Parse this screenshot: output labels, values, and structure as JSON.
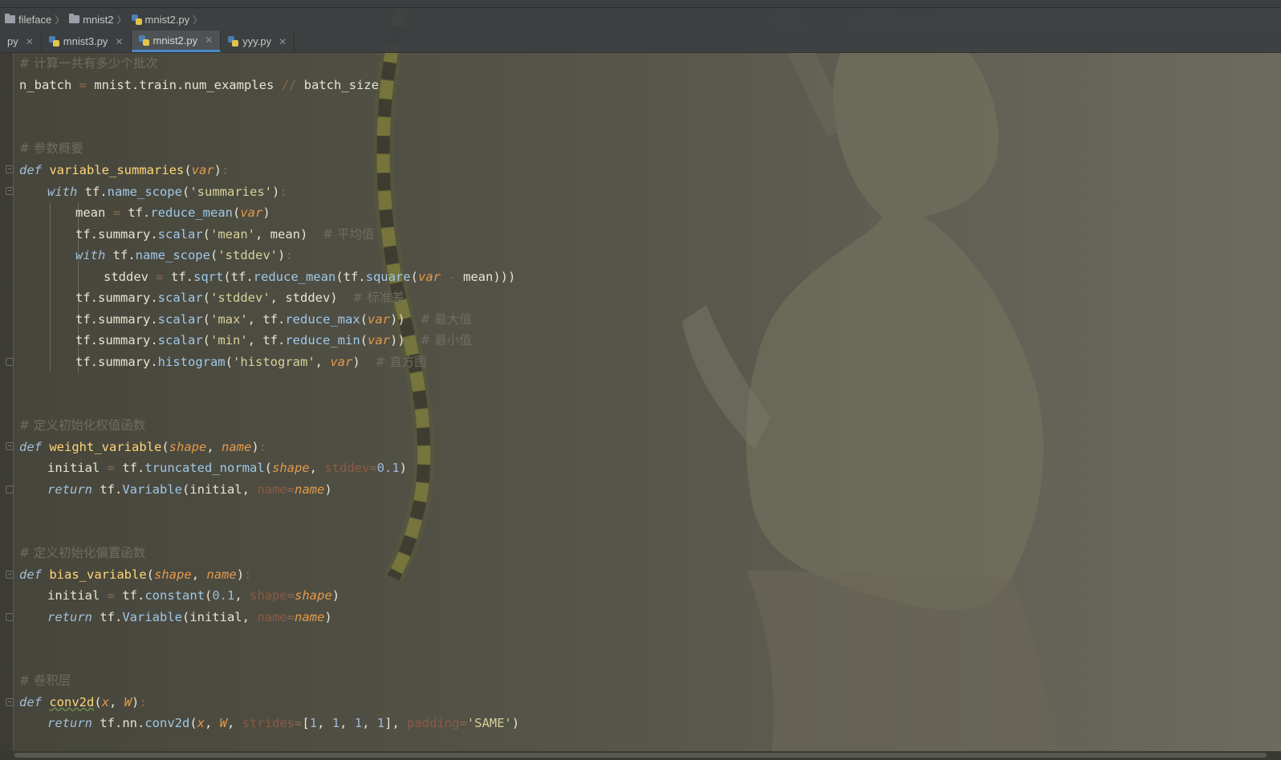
{
  "breadcrumb": [
    "fileface",
    "mnist2",
    "mnist2.py"
  ],
  "tabs": [
    {
      "label": "py",
      "active": false
    },
    {
      "label": "mnist3.py",
      "active": false
    },
    {
      "label": "mnist2.py",
      "active": true
    },
    {
      "label": "yyy.py",
      "active": false
    }
  ],
  "icons": {
    "folder": "folder-icon",
    "python_file": "python-file-icon",
    "close": "close-icon",
    "fold": "fold-marker-icon"
  },
  "colors": {
    "accent": "#4a88c7",
    "keyword": "#a3bfd9",
    "function": "#ffd677",
    "string": "#d6d19a",
    "param": "#e39a4a",
    "comment": "#6e6c60"
  },
  "code": {
    "l1": "# 计算一共有多少个批次",
    "l2": "n_batch = mnist.train.num_examples // batch_size",
    "l5": "# 参数概要",
    "l6": "def variable_summaries(var):",
    "l7": "with tf.name_scope('summaries'):",
    "l8": "mean = tf.reduce_mean(var)",
    "l9": "tf.summary.scalar('mean', mean)  # 平均值",
    "l10": "with tf.name_scope('stddev'):",
    "l11": "stddev = tf.sqrt(tf.reduce_mean(tf.square(var - mean)))",
    "l12": "tf.summary.scalar('stddev', stddev)  # 标准差",
    "l13": "tf.summary.scalar('max', tf.reduce_max(var))  # 最大值",
    "l14": "tf.summary.scalar('min', tf.reduce_min(var))  # 最小值",
    "l15": "tf.summary.histogram('histogram', var)  # 直方图",
    "l18": "# 定义初始化权值函数",
    "l19": "def weight_variable(shape, name):",
    "l20": "initial = tf.truncated_normal(shape, stddev=0.1)",
    "l21": "return tf.Variable(initial, name=name)",
    "l24": "# 定义初始化偏置函数",
    "l25": "def bias_variable(shape, name):",
    "l26": "initial = tf.constant(0.1, shape=shape)",
    "l27": "return tf.Variable(initial, name=name)",
    "l30": "# 卷积层",
    "l31": "def conv2d(x, W):",
    "l32": "return tf.nn.conv2d(x, W, strides=[1, 1, 1, 1], padding='SAME')"
  }
}
